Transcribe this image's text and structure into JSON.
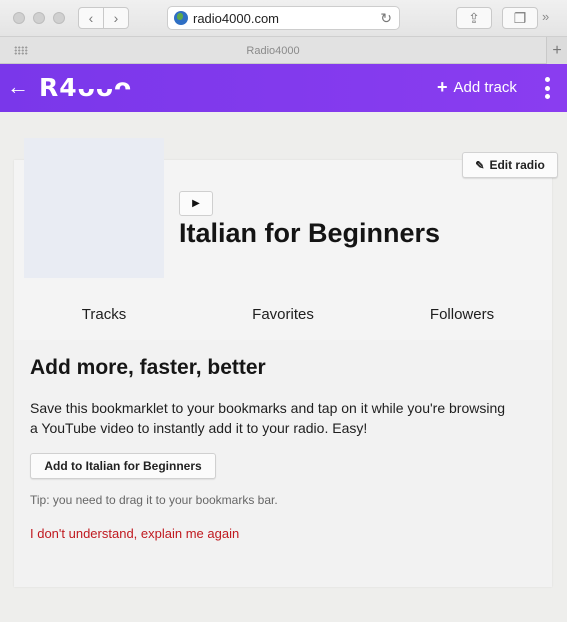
{
  "browser": {
    "url": "radio4000.com",
    "tab_title": "Radio4000",
    "back_glyph": "‹",
    "forward_glyph": "›",
    "reload_glyph": "↻",
    "share_glyph": "⇪",
    "tabs_glyph": "❐",
    "more_glyph": "»",
    "new_tab_glyph": "+"
  },
  "header": {
    "back_glyph": "←",
    "logo": "R4ᴗᴗᴖ",
    "add_track_label": "Add track",
    "plus_glyph": "+",
    "accent_color": "#7f3aed"
  },
  "channel": {
    "edit_label": "Edit radio",
    "title": "Italian for Beginners",
    "play_glyph": "▶"
  },
  "tabs": [
    {
      "label": "Tracks"
    },
    {
      "label": "Favorites"
    },
    {
      "label": "Followers"
    }
  ],
  "bookmarklet": {
    "heading": "Add more, faster, better",
    "description": "Save this bookmarklet to your bookmarks and tap on it while you're browsing a YouTube video to instantly add it to your radio. Easy!",
    "button_label": "Add to Italian for Beginners",
    "tip": "Tip: you need to drag it to your bookmarks bar.",
    "explain_link": "I don't understand, explain me again",
    "link_color": "#c0191f"
  }
}
